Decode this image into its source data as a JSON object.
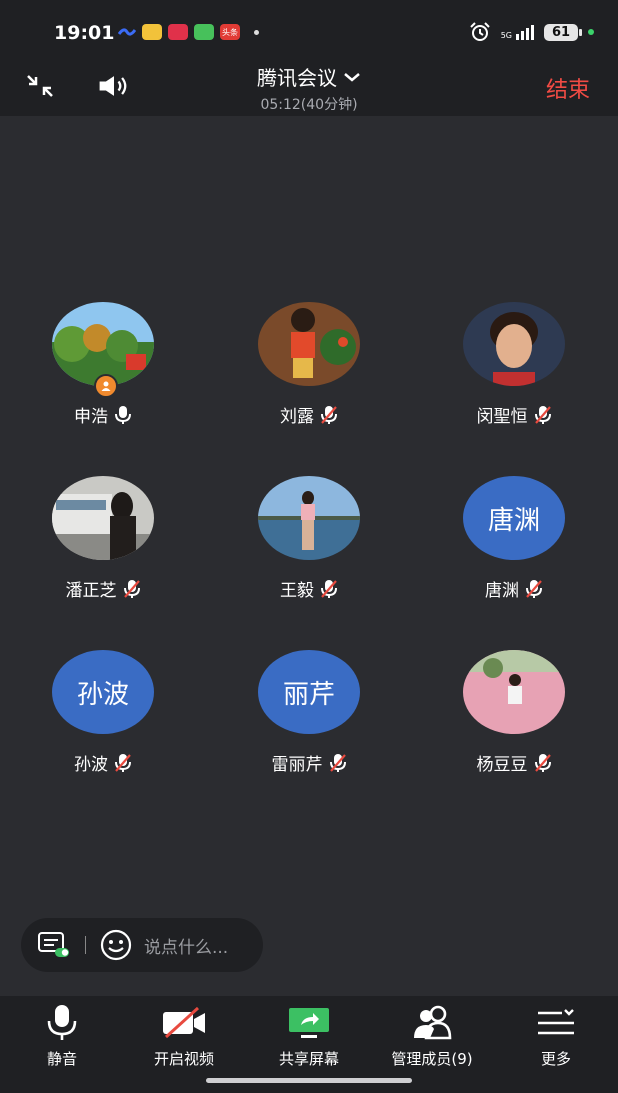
{
  "status_bar": {
    "time": "19:01",
    "network": "5G",
    "battery": "61",
    "apps": [
      {
        "name": "lark-icon",
        "color": "#3b6cf6"
      },
      {
        "name": "notes-app-icon",
        "color": "#f2c23a"
      },
      {
        "name": "pinduoduo-icon",
        "color": "#e0314a"
      },
      {
        "name": "messages-icon",
        "color": "#47c15b"
      },
      {
        "name": "toutiao-icon",
        "color": "#e13b35"
      }
    ],
    "app_text": {
      "toutiao": "头条"
    }
  },
  "meeting": {
    "title": "腾讯会议",
    "duration": "05:12(40分钟)",
    "end_label": "结束"
  },
  "participants": [
    {
      "name": "申浩",
      "avatar_type": "photo",
      "muted": false,
      "host": true
    },
    {
      "name": "刘露",
      "avatar_type": "photo",
      "muted": true,
      "host": false
    },
    {
      "name": "闵聖恒",
      "avatar_type": "photo",
      "muted": true,
      "host": false
    },
    {
      "name": "潘正芝",
      "avatar_type": "photo",
      "muted": true,
      "host": false
    },
    {
      "name": "王毅",
      "avatar_type": "photo",
      "muted": true,
      "host": false
    },
    {
      "name": "唐渊",
      "avatar_type": "text",
      "avatar_text": "唐渊",
      "muted": true,
      "host": false
    },
    {
      "name": "孙波",
      "avatar_type": "text",
      "avatar_text": "孙波",
      "muted": true,
      "host": false
    },
    {
      "name": "雷丽芹",
      "avatar_type": "text",
      "avatar_text": "丽芹",
      "muted": true,
      "host": false
    },
    {
      "name": "杨豆豆",
      "avatar_type": "photo",
      "muted": true,
      "host": false
    }
  ],
  "chat": {
    "placeholder": "说点什么..."
  },
  "toolbar": {
    "mute": "静音",
    "video": "开启视频",
    "share": "共享屏幕",
    "members": "管理成员(9)",
    "more": "更多"
  },
  "colors": {
    "background": "#2b2c30",
    "bar": "#1f2023",
    "end": "#f04b44",
    "avatar_blue": "#3a6cc4",
    "share_green": "#3cc063",
    "host_orange": "#f08a2e"
  }
}
